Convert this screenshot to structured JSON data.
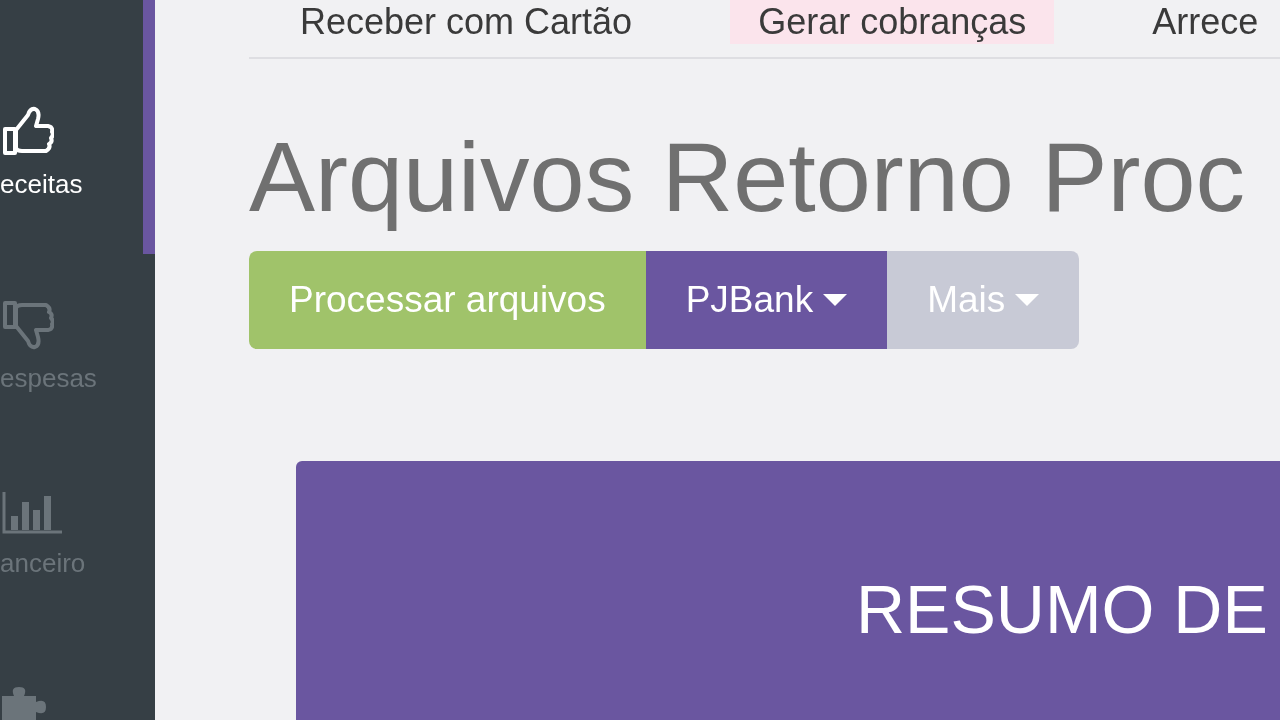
{
  "sidebar": {
    "items": [
      {
        "label": "eceitas",
        "selected": true
      },
      {
        "label": "espesas",
        "selected": false
      },
      {
        "label": "anceiro",
        "selected": false
      },
      {
        "selected": false
      }
    ]
  },
  "top_tabs": [
    {
      "label": "Receber com Cartão",
      "selected": false
    },
    {
      "label": "Gerar cobranças",
      "selected": true
    },
    {
      "label": "Arrece",
      "selected": false
    }
  ],
  "page": {
    "title": "Arquivos Retorno Proc"
  },
  "actions": [
    {
      "label": "Processar arquivos",
      "kind": "button",
      "color": "#a0c36a"
    },
    {
      "label": "PJBank",
      "kind": "dropdown",
      "color": "#6a56a0"
    },
    {
      "label": "Mais",
      "kind": "dropdown",
      "color": "#c8cad6"
    }
  ],
  "summary_card": {
    "title": "RESUMO DE"
  }
}
